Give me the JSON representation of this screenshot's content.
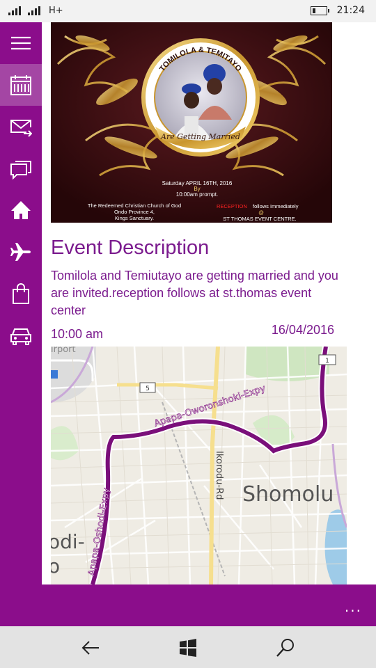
{
  "status": {
    "network": "H+",
    "time": "21:24"
  },
  "sidebar": {
    "items": [
      {
        "icon": "hamburger-menu-icon"
      },
      {
        "icon": "calendar-icon"
      },
      {
        "icon": "mail-forward-icon"
      },
      {
        "icon": "chat-icon"
      },
      {
        "icon": "home-icon"
      },
      {
        "icon": "airplane-icon"
      },
      {
        "icon": "shopping-bag-icon"
      },
      {
        "icon": "car-icon"
      }
    ]
  },
  "invite": {
    "names": "TOMILOLA & TEMITAYO",
    "tagline": "Are Getting Married",
    "date_line": "Saturday APRIL 16TH, 2016",
    "by": "By",
    "time_line": "10:00am prompt.",
    "church_line1": "The Redeemed Christian Church of God",
    "church_line2": "Ondo Province 4,",
    "church_line3": "Kings Sanctuary.",
    "reception_word": "RECEPTION",
    "reception_rest": "follows Immediately",
    "at": "@",
    "venue": "ST THOMAS EVENT CENTRE."
  },
  "event": {
    "title": "Event Description",
    "description": "Tomilola and Temiutayo are getting married and you are invited.reception follows at st.thomas event center",
    "time": "10:00 am",
    "date": "16/04/2016"
  },
  "map": {
    "labels": {
      "airport": "irport",
      "road1": "Apapa-Oworonshoki-Expy",
      "road2": "Ikorodu-Rd",
      "road3": "Apapa-Oshodi-Expy",
      "area": "Shomolu",
      "area2a": "odi-",
      "area2b": "o",
      "shield5": "5",
      "shield1": "1"
    }
  },
  "appbar": {
    "more": "..."
  },
  "navbar": {
    "back": "back-arrow-icon",
    "start": "windows-logo-icon",
    "search": "search-icon"
  }
}
